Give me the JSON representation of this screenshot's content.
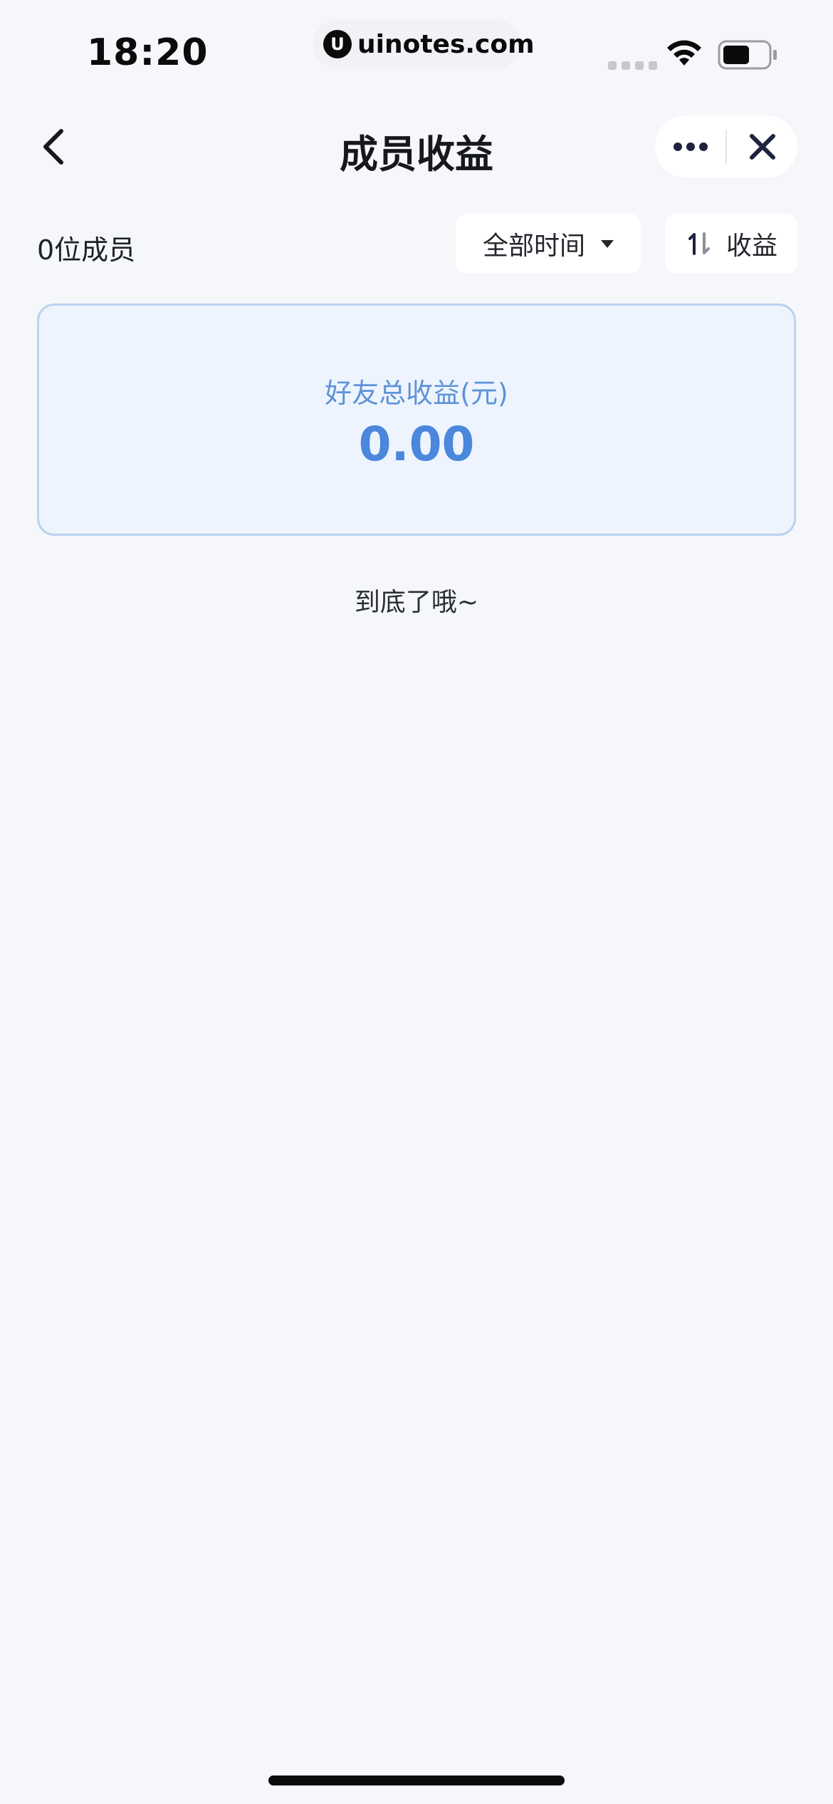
{
  "status_bar": {
    "time": "18:20",
    "url": "uinotes.com",
    "url_logo": "U",
    "icons": [
      "signal-icon",
      "wifi-icon",
      "battery-icon"
    ]
  },
  "nav": {
    "title": "成员收益",
    "icons": [
      "back-chevron-icon",
      "more-dots-icon",
      "close-icon"
    ]
  },
  "filters": {
    "member_count": "0位成员",
    "time_filter": "全部时间",
    "sort_label": "收益"
  },
  "summary": {
    "label": "好友总收益(元)",
    "value": "0.00"
  },
  "end_text": "到底了哦~",
  "colors": {
    "background": "#f6f7fa",
    "card_background": "#eef4fd",
    "card_border": "#b9d2ef",
    "accent_blue": "#4a87dd",
    "text_dark": "#1d1f24"
  }
}
